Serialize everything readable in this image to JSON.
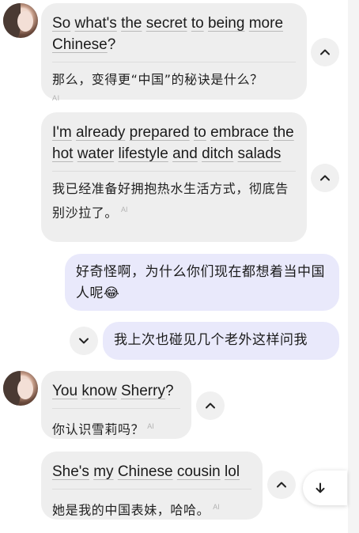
{
  "messages": [
    {
      "role": "assistant",
      "english_words": [
        [
          "So",
          " "
        ],
        [
          "what's",
          " "
        ],
        [
          "the",
          " "
        ],
        [
          "secret",
          " "
        ],
        [
          "to",
          " "
        ],
        [
          "being",
          " "
        ],
        [
          "more",
          " "
        ],
        [
          "Chinese",
          ""
        ],
        [
          "?",
          ""
        ]
      ],
      "translation": "那么，变得更“中国”的秘诀是什么？",
      "ai_badge": "AI"
    },
    {
      "role": "assistant",
      "english_words": [
        [
          "I'm",
          " "
        ],
        [
          "already",
          " "
        ],
        [
          "prepared",
          " "
        ],
        [
          "to",
          " "
        ],
        [
          "embrace",
          " "
        ],
        [
          "the",
          " "
        ],
        [
          "hot",
          " "
        ],
        [
          "water",
          " "
        ],
        [
          "lifestyle",
          " "
        ],
        [
          "and",
          " "
        ],
        [
          "ditch",
          " "
        ],
        [
          "salads",
          ""
        ]
      ],
      "translation": "我已经准备好拥抱热水生活方式，彻底告别沙拉了。",
      "ai_badge": "AI"
    },
    {
      "role": "user",
      "text": "好奇怪啊，为什么你们现在都想着当中国人呢😂"
    },
    {
      "role": "user",
      "text": "我上次也碰见几个老外这样问我"
    },
    {
      "role": "assistant",
      "english_words": [
        [
          "You",
          " "
        ],
        [
          "know",
          " "
        ],
        [
          "Sherry",
          ""
        ],
        [
          "?",
          ""
        ]
      ],
      "translation": "你认识雪莉吗？",
      "ai_badge": "AI"
    },
    {
      "role": "assistant",
      "english_words": [
        [
          "She's",
          " "
        ],
        [
          "my",
          " "
        ],
        [
          "Chinese",
          " "
        ],
        [
          "cousin",
          " "
        ],
        [
          "lol",
          ""
        ]
      ],
      "translation": "她是我的中国表妹，哈哈。",
      "ai_badge": "AI"
    }
  ],
  "icons": {
    "collapse": "chevron-up-icon",
    "expand": "chevron-down-icon",
    "scroll_down": "arrow-down-icon"
  },
  "colors": {
    "incoming_bubble": "#eeeeee",
    "outgoing_bubble": "#e9e9fb",
    "separator": "#dcdcdc"
  }
}
